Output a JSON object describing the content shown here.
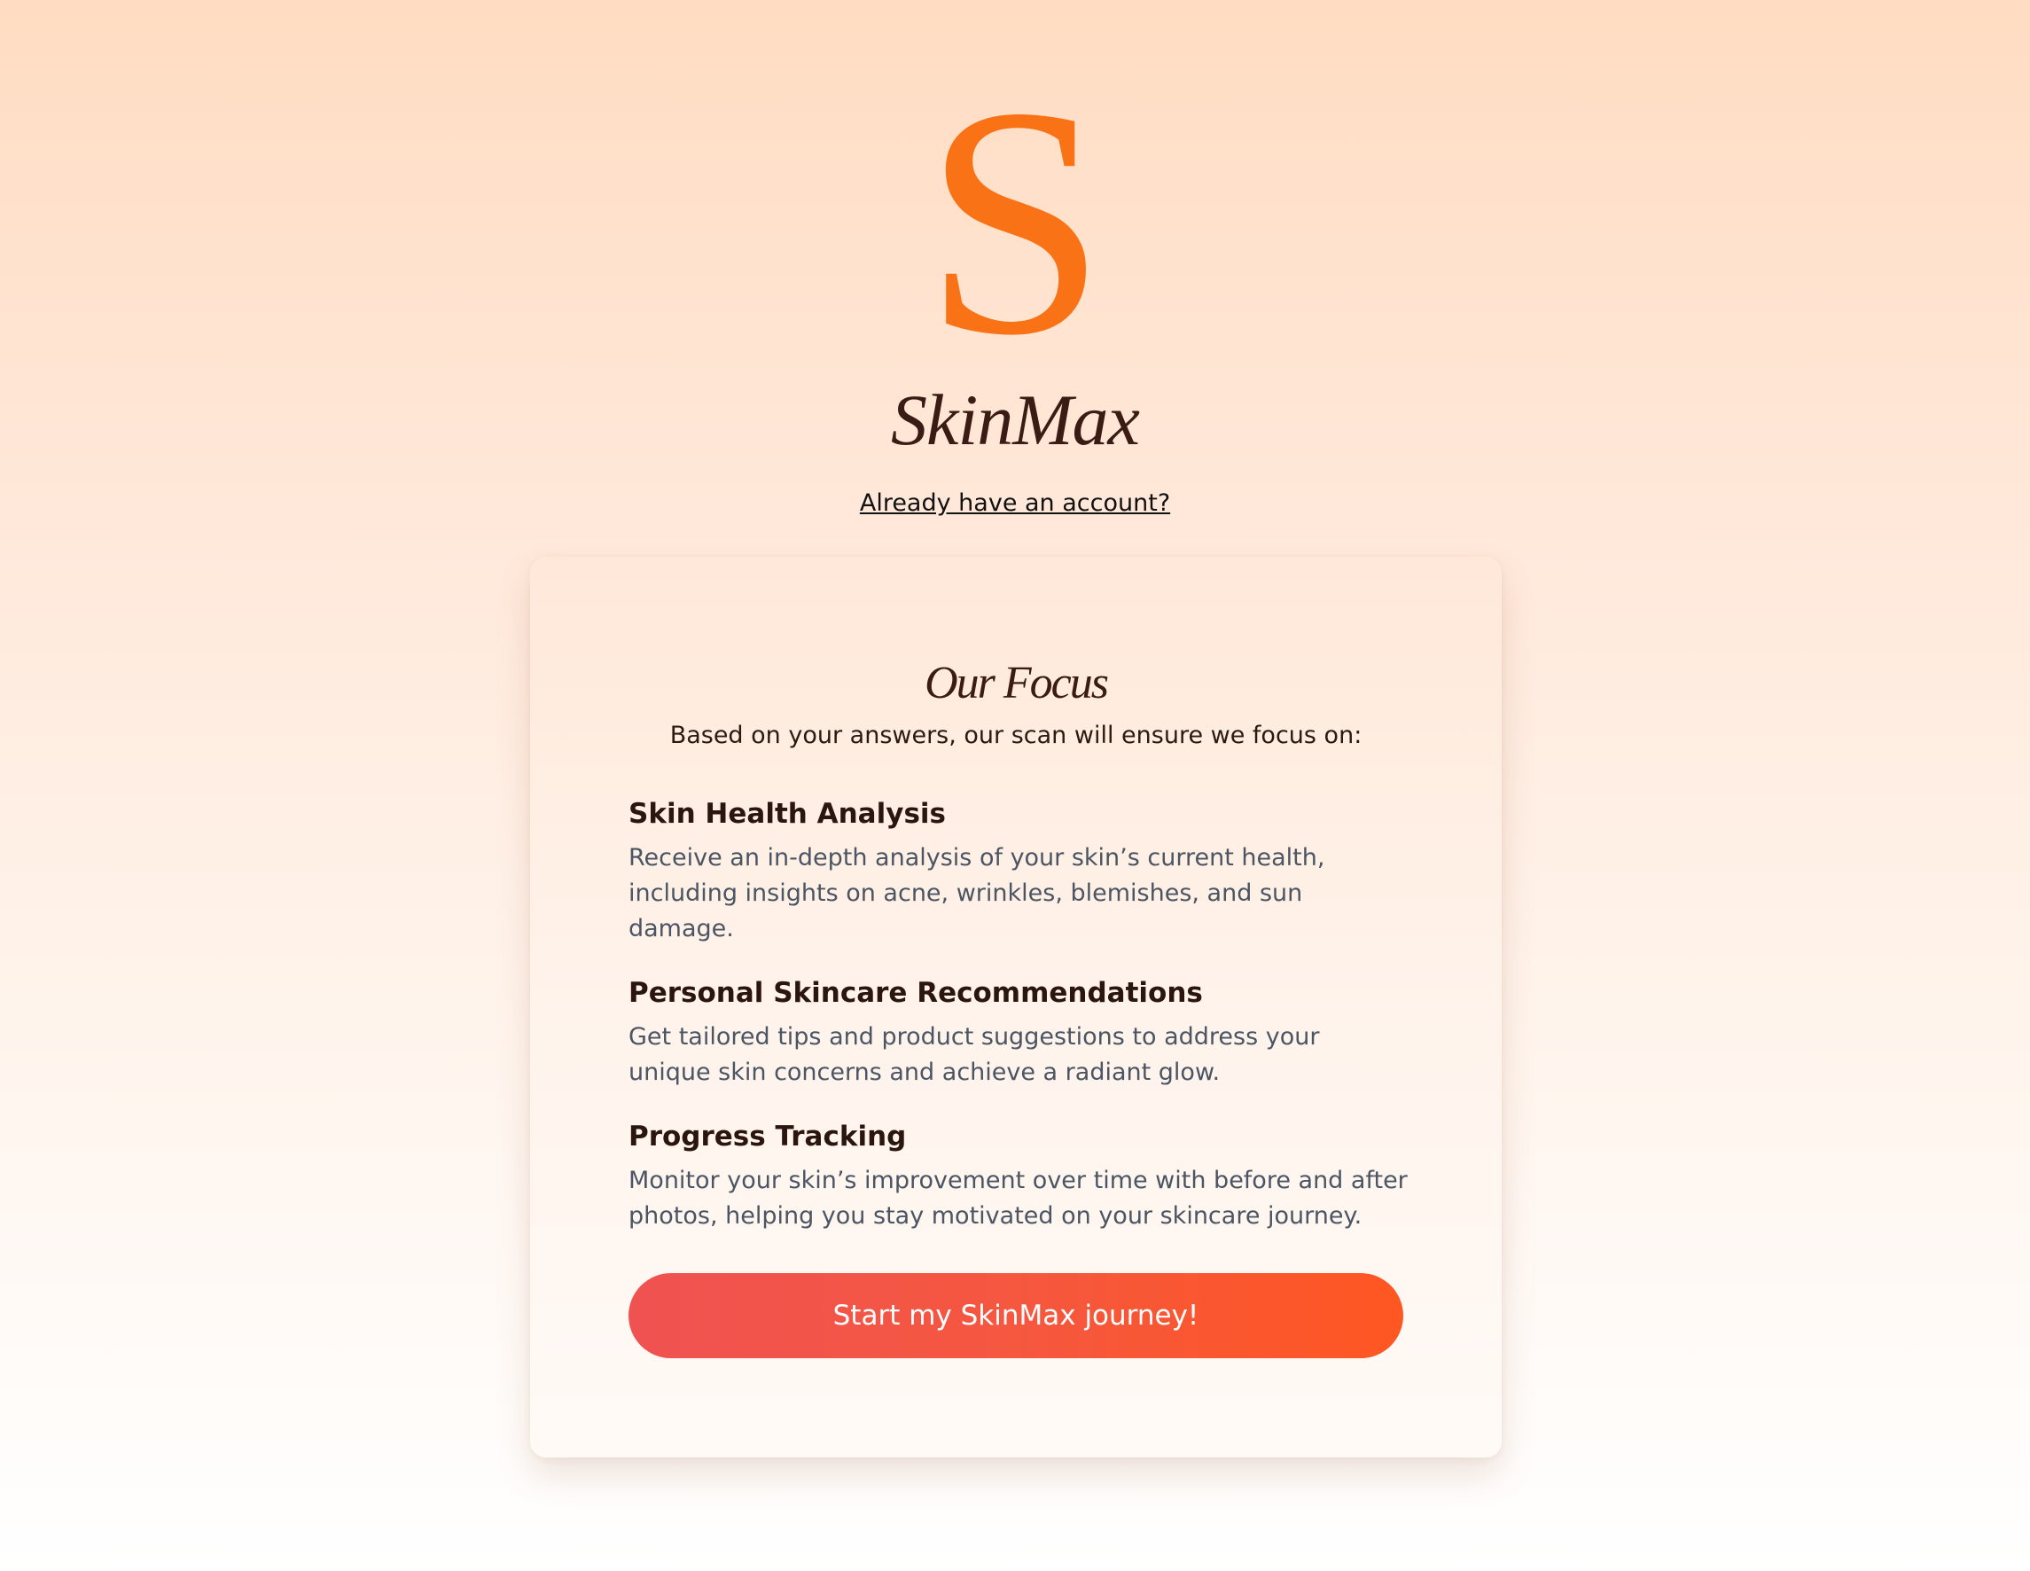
{
  "brand": {
    "logo_letter": "S",
    "name": "SkinMax",
    "logo_color": "#f97316"
  },
  "header": {
    "login_link": "Already have an account?"
  },
  "card": {
    "title": "Our Focus",
    "subtitle": "Based on your answers, our scan will ensure we focus on:",
    "features": [
      {
        "title": "Skin Health Analysis",
        "description": "Receive an in-depth analysis of your skin’s current health, including insights on acne, wrinkles, blemishes, and sun damage."
      },
      {
        "title": "Personal Skincare Recommendations",
        "description": "Get tailored tips and product suggestions to address your unique skin concerns and achieve a radiant glow."
      },
      {
        "title": "Progress Tracking",
        "description": "Monitor your skin’s improvement over time with before and after photos, helping you stay motivated on your skincare journey."
      }
    ],
    "cta_label": "Start my SkinMax journey!"
  },
  "colors": {
    "accent": "#f97316",
    "cta_start": "#f05252",
    "cta_end": "#ff5722",
    "heading": "#3b1c14",
    "body_text": "#4b5563"
  }
}
